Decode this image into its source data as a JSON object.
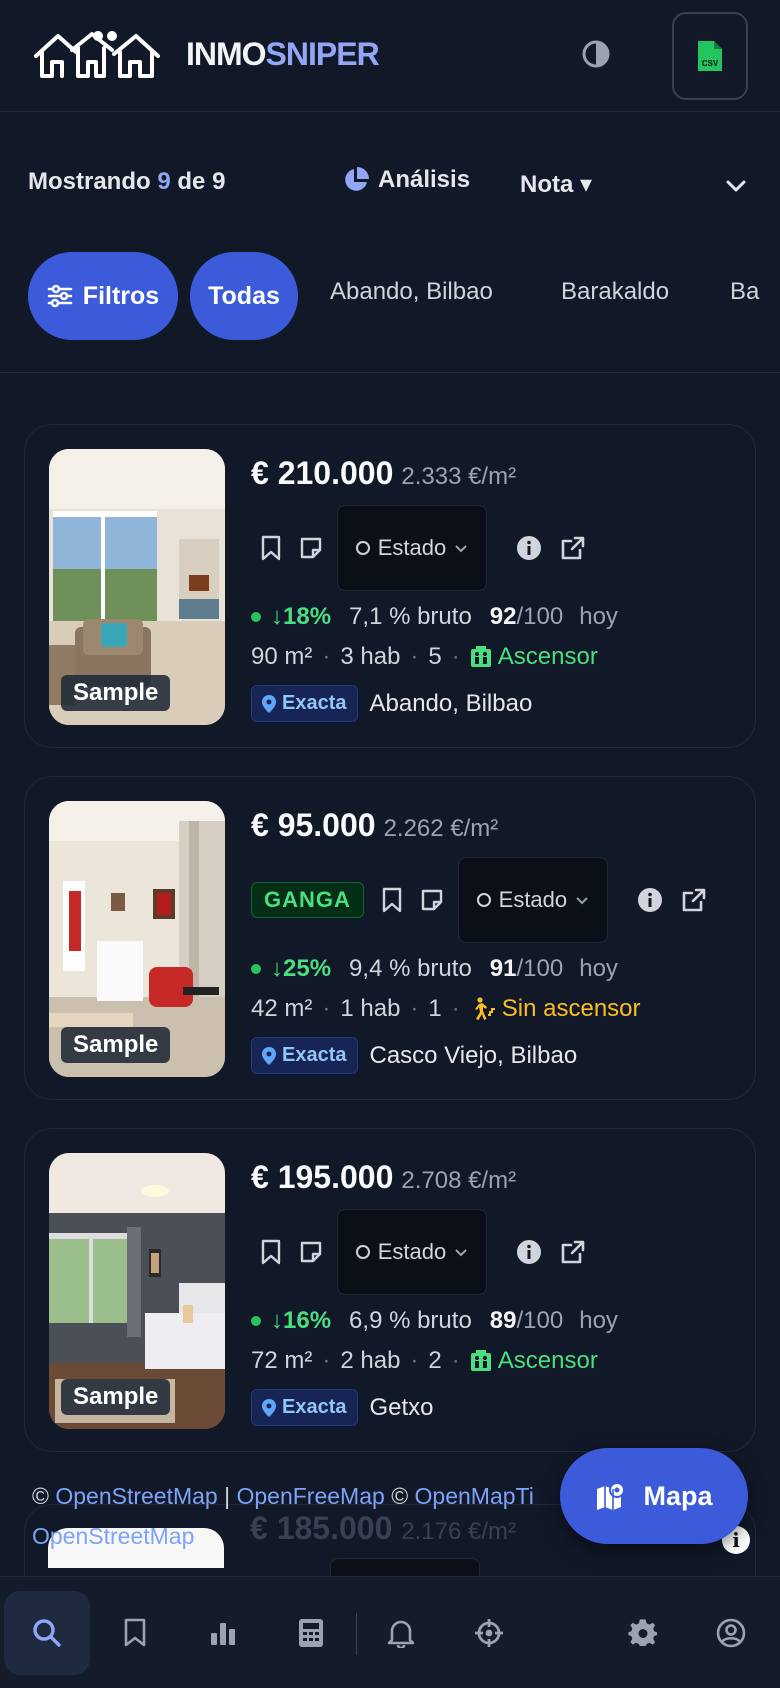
{
  "header": {
    "brand_part1": "INMO",
    "brand_part2": "SNIPER",
    "csv_label": "CSV"
  },
  "toolbar": {
    "showing_prefix": "Mostrando",
    "showing_count": "9",
    "showing_of": "de",
    "showing_total": "9",
    "analysis_label": "Análisis",
    "sort_label": "Nota ▾"
  },
  "chips": {
    "filters_label": "Filtros",
    "all_label": "Todas",
    "locations": [
      "Abando, Bilbao",
      "Barakaldo",
      "Ba"
    ]
  },
  "cards": [
    {
      "price": "€ 210.000",
      "price_per_m2": "2.333 €/m²",
      "badge": "",
      "estado_label": "Estado",
      "drop": "↓18%",
      "yield": "7,1 % bruto",
      "score": "92",
      "score_max": "/100",
      "when": "hoy",
      "area": "90 m²",
      "rooms": "3 hab",
      "floor": "5",
      "lift_label": "Ascensor",
      "lift": true,
      "precision": "Exacta",
      "location": "Abando, Bilbao",
      "sample": "Sample"
    },
    {
      "price": "€ 95.000",
      "price_per_m2": "2.262 €/m²",
      "badge": "GANGA",
      "estado_label": "Estado",
      "drop": "↓25%",
      "yield": "9,4 % bruto",
      "score": "91",
      "score_max": "/100",
      "when": "hoy",
      "area": "42 m²",
      "rooms": "1 hab",
      "floor": "1",
      "lift_label": "Sin ascensor",
      "lift": false,
      "precision": "Exacta",
      "location": "Casco Viejo, Bilbao",
      "sample": "Sample"
    },
    {
      "price": "€ 195.000",
      "price_per_m2": "2.708 €/m²",
      "badge": "",
      "estado_label": "Estado",
      "drop": "↓16%",
      "yield": "6,9 % bruto",
      "score": "89",
      "score_max": "/100",
      "when": "hoy",
      "area": "72 m²",
      "rooms": "2 hab",
      "floor": "2",
      "lift_label": "Ascensor",
      "lift": true,
      "precision": "Exacta",
      "location": "Getxo",
      "sample": "Sample"
    }
  ],
  "ghost_card": {
    "price": "€ 185.000",
    "price_per_m2": "2.176 €/m²"
  },
  "map_attribution": {
    "copy1": "©",
    "osm": "OpenStreetMap",
    "sep": "|",
    "ofm": "OpenFreeMap",
    "copy2": "©",
    "omt": "OpenMapTi",
    "osm2": "OpenStreetMap"
  },
  "map_button": {
    "label": "Mapa"
  },
  "colors": {
    "background": "#111827",
    "accent": "#3b5bdb",
    "brand_accent": "#93a5f5",
    "positive": "#4ade80",
    "warning": "#fbbf24"
  },
  "bottom_nav": {
    "items": [
      "search-icon",
      "bookmark-icon",
      "bar-chart-icon",
      "calculator-icon",
      "bell-icon",
      "crosshair-icon",
      "gear-icon",
      "user-circle-icon"
    ]
  }
}
